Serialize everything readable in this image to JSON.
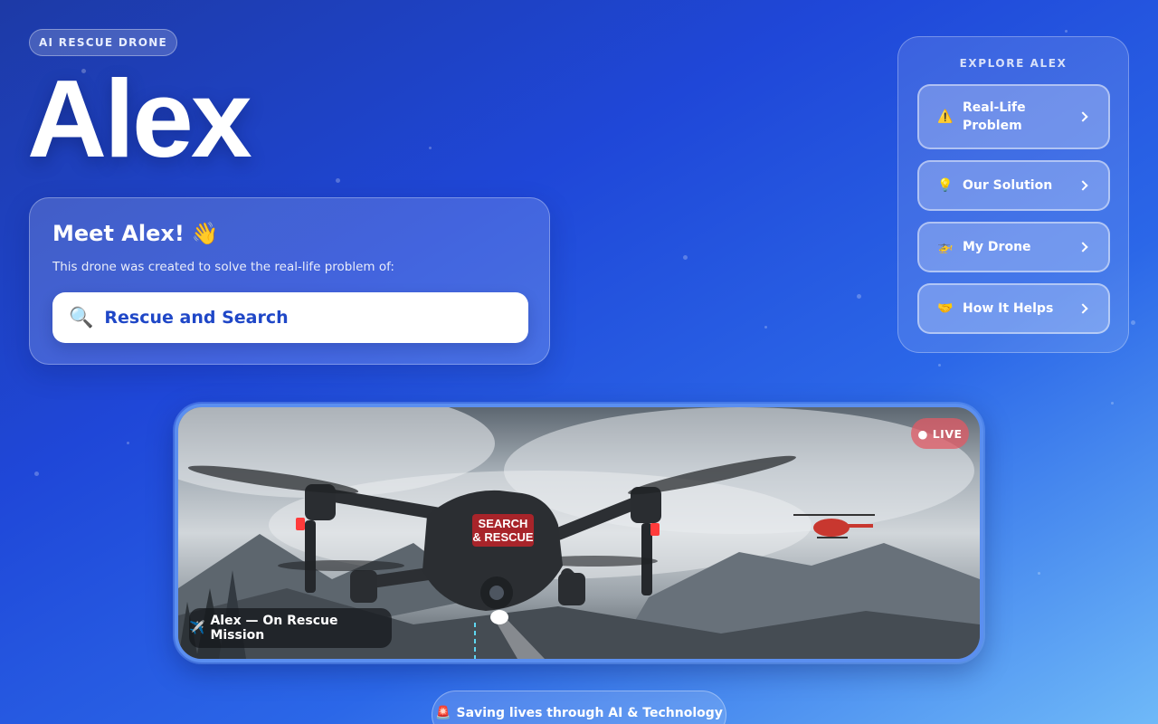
{
  "badge": "AI RESCUE DRONE",
  "title": "Alex",
  "meet": {
    "heading": "Meet Alex!",
    "wave": "👋",
    "subtitle": "This drone was created to solve the real-life problem of:",
    "problem_icon": "🔍",
    "problem": "Rescue and Search"
  },
  "explore": {
    "title": "EXPLORE ALEX",
    "items": [
      {
        "icon": "⚠️",
        "icon_name": "warning-icon",
        "label": "Real-Life Problem"
      },
      {
        "icon": "💡",
        "icon_name": "lightbulb-icon",
        "label": "Our Solution"
      },
      {
        "icon": "🚁",
        "icon_name": "helicopter-icon",
        "label": "My Drone"
      },
      {
        "icon": "🤝",
        "icon_name": "handshake-icon",
        "label": "How It Helps"
      }
    ]
  },
  "hero": {
    "live": "● LIVE",
    "drone_label_1": "SEARCH",
    "drone_label_2": "& RESCUE",
    "caption_icon": "✈️",
    "caption": "Alex — On Rescue Mission"
  },
  "footer": {
    "icon": "🚨",
    "text": "Saving lives through AI & Technology"
  },
  "colors": {
    "accent": "#1f47c7",
    "live": "#e15a64",
    "frame": "#5b8ff0"
  }
}
